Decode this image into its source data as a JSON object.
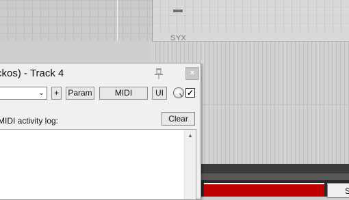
{
  "arrange": {
    "syx_label": "SYX"
  },
  "fx_window": {
    "title": "ckos) - Track 4",
    "close_label": "×",
    "toolbar": {
      "preset_value": "",
      "plus_label": "+",
      "param_label": "Param",
      "midi_label": "MIDI",
      "ui_label": "UI",
      "checkbox_checked": true
    },
    "log_label": "MIDI activity log:",
    "clear_label": "Clear"
  },
  "bottom_strip": {
    "button_label": "S"
  },
  "colors": {
    "meter_red": "#c10000",
    "window_bg": "#f0f0f0"
  }
}
